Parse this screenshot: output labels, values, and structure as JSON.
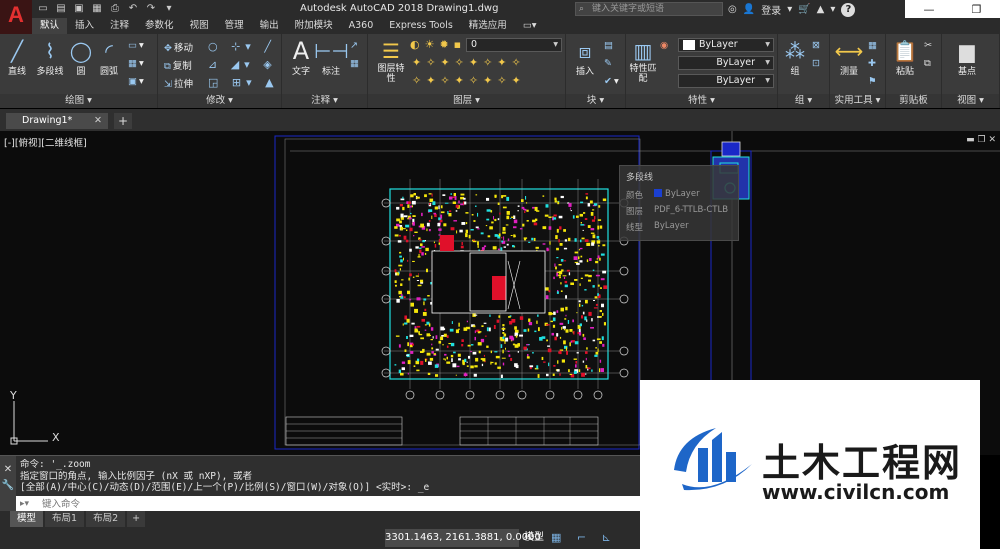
{
  "app": {
    "title": "Autodesk AutoCAD 2018    Drawing1.dwg",
    "logo_letter": "A",
    "search_placeholder": "键入关键字或短语",
    "login_label": "登录"
  },
  "ribbon_tabs": [
    "默认",
    "插入",
    "注释",
    "参数化",
    "视图",
    "管理",
    "输出",
    "附加模块",
    "A360",
    "Express Tools",
    "精选应用"
  ],
  "ribbon": {
    "draw": {
      "title": "绘图",
      "line": "直线",
      "polyline": "多段线",
      "circle": "圆",
      "arc": "圆弧"
    },
    "modify": {
      "title": "修改",
      "move": "移动",
      "copy": "复制",
      "stretch": "拉伸"
    },
    "annotation": {
      "title": "注释",
      "text": "文字",
      "dimension": "标注"
    },
    "layers": {
      "title": "图层",
      "layer_props": "图层特性",
      "current_layer": "0"
    },
    "block": {
      "title": "块",
      "insert": "插入"
    },
    "properties": {
      "title": "特性",
      "match": "特性匹配",
      "color": "ByLayer",
      "linetype": "ByLayer",
      "lineweight": "ByLayer"
    },
    "groups": {
      "title": "组",
      "group": "组"
    },
    "utilities": {
      "title": "实用工具",
      "measure": "测量"
    },
    "clipboard": {
      "title": "剪贴板",
      "paste": "粘贴"
    },
    "view": {
      "title": "视图",
      "base": "基点"
    }
  },
  "document": {
    "tab_name": "Drawing1*",
    "viewport_label": "[-][俯视][二维线框]"
  },
  "tooltip": {
    "title": "多段线",
    "rows": [
      {
        "key": "颜色",
        "value": "ByLayer"
      },
      {
        "key": "图层",
        "value": "PDF_6-TTLB-CTLB"
      },
      {
        "key": "线型",
        "value": "ByLayer"
      }
    ]
  },
  "ucs": {
    "x": "X",
    "y": "Y"
  },
  "command": {
    "history": [
      "命令: '_.zoom",
      "指定窗口的角点, 输入比例因子 (nX 或 nXP), 或者",
      "[全部(A)/中心(C)/动态(D)/范围(E)/上一个(P)/比例(S)/窗口(W)/对象(O)] <实时>: _e"
    ],
    "input_placeholder": "键入命令"
  },
  "layout_tabs": [
    "模型",
    "布局1",
    "布局2"
  ],
  "status": {
    "coords": "3301.1463, 2161.3881, 0.0000",
    "model": "模型"
  },
  "watermark": {
    "title": "土木工程网",
    "url": "www.civilcn.com"
  },
  "colors": {
    "cad_yellow": "#f5e60a",
    "cad_red": "#e0102a",
    "cad_magenta": "#e020c0",
    "cad_cyan": "#20e0e0",
    "frame_blue": "#1a28c8",
    "logo_blue": "#1e66c8"
  }
}
